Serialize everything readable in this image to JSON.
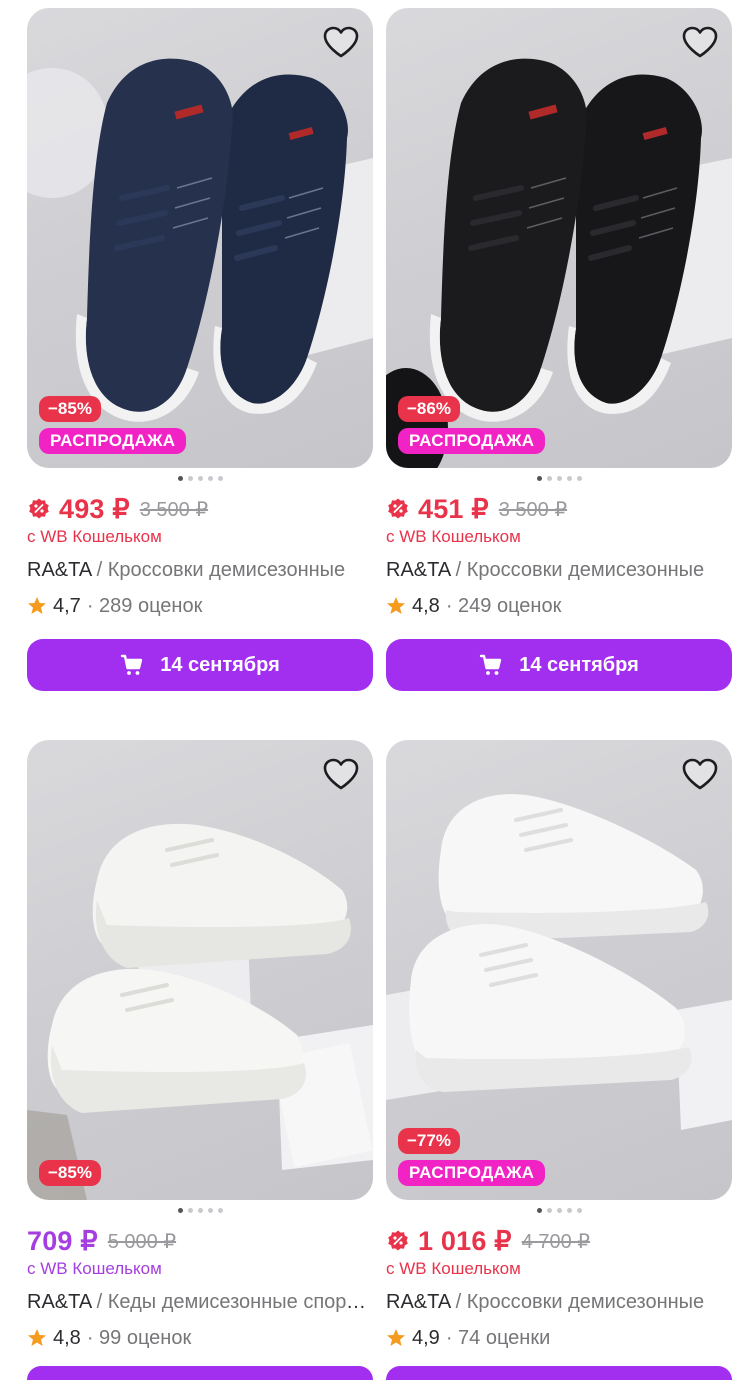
{
  "colors": {
    "accent_purple": "#a22ef0",
    "discount_red": "#e8334a",
    "sale_pink": "#f223c4"
  },
  "products": [
    {
      "discount": "−85%",
      "sale": "РАСПРОДАЖА",
      "price": "493 ₽",
      "old_price": "3 500 ₽",
      "wallet": "с WB Кошельком",
      "brand": "RA&TA",
      "sep": " / ",
      "name": "Кроссовки демисезонные",
      "rating": "4,7",
      "reviews": "· 289 оценок",
      "delivery": "14 сентября",
      "shoe_color": "navy"
    },
    {
      "discount": "−86%",
      "sale": "РАСПРОДАЖА",
      "price": "451 ₽",
      "old_price": "3 500 ₽",
      "wallet": "с WB Кошельком",
      "brand": "RA&TA",
      "sep": " / ",
      "name": "Кроссовки демисезонные",
      "rating": "4,8",
      "reviews": "· 249 оценок",
      "delivery": "14 сентября",
      "shoe_color": "black"
    },
    {
      "discount": "−85%",
      "price": "709 ₽",
      "old_price": "5 000 ₽",
      "wallet": "с WB Кошельком",
      "brand": "RA&TA",
      "sep": " / ",
      "name": "Кеды демисезонные спортивные",
      "rating": "4,8",
      "reviews": "· 99 оценок",
      "shoe_color": "white-platform"
    },
    {
      "discount": "−77%",
      "sale": "РАСПРОДАЖА",
      "price": "1 016 ₽",
      "old_price": "4 700 ₽",
      "wallet": "с WB Кошельком",
      "brand": "RA&TA",
      "sep": " / ",
      "name": "Кроссовки демисезонные",
      "rating": "4,9",
      "reviews": "· 74 оценки",
      "shoe_color": "white"
    }
  ],
  "icons": {
    "favorite": "heart-icon",
    "wallet_badge": "wallet-discount-icon",
    "rating": "star-icon",
    "cart": "cart-icon"
  }
}
